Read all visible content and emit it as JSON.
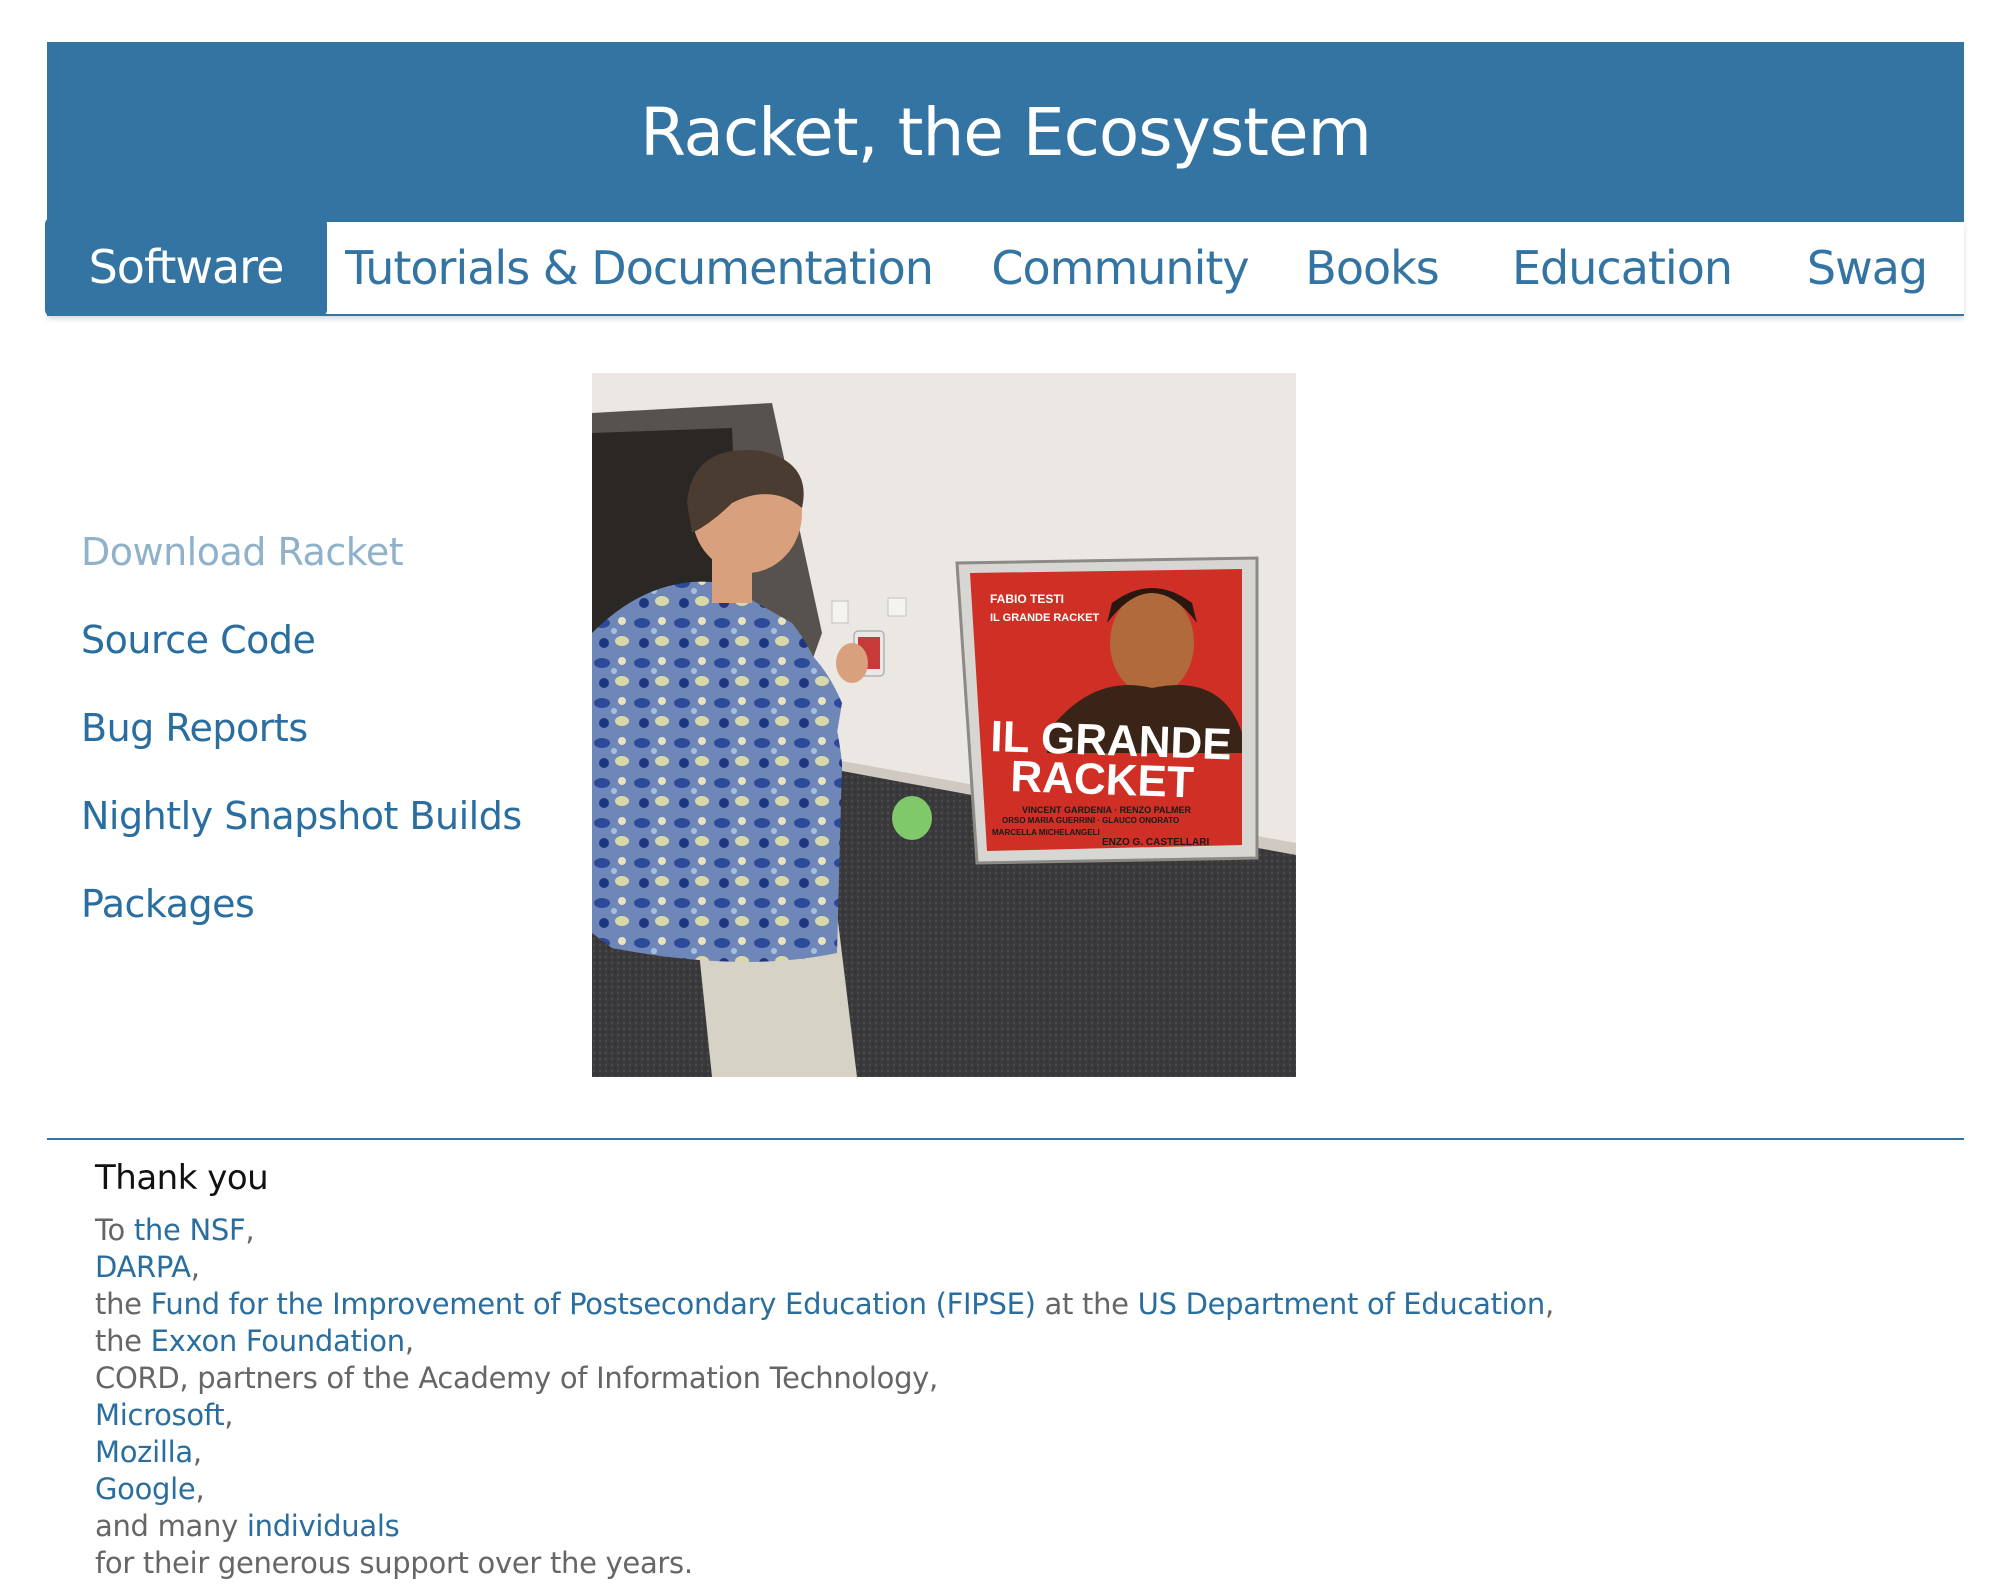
{
  "header": {
    "title": "Racket, the Ecosystem"
  },
  "nav": {
    "items": [
      {
        "label": "Software"
      },
      {
        "label": "Tutorials & Documentation"
      },
      {
        "label": "Community"
      },
      {
        "label": "Books"
      },
      {
        "label": "Education"
      },
      {
        "label": "Swag"
      }
    ],
    "active": "Software"
  },
  "sidebar": {
    "links": [
      {
        "label": "Download Racket"
      },
      {
        "label": "Source Code"
      },
      {
        "label": "Bug Reports"
      },
      {
        "label": "Nightly Snapshot Builds"
      },
      {
        "label": "Packages"
      }
    ]
  },
  "poster": {
    "line1": "FABIO TESTI",
    "line2": "IL GRANDE RACKET",
    "title_a": "IL GRANDE",
    "title_b": "RACKET",
    "credits1": "VINCENT GARDENIA · RENZO PALMER",
    "credits2": "ORSO MARIA GUERRINI · GLAUCO ONORATO",
    "credits3": "MARCELLA MICHELANGELI",
    "director": "ENZO G. CASTELLARI"
  },
  "footer": {
    "title": "Thank you",
    "to": "To ",
    "nsf": "the NSF",
    "comma": ",",
    "darpa": "DARPA",
    "the1": "the ",
    "fipse": "Fund for the Improvement of Postsecondary Education (FIPSE)",
    "at_the": " at the ",
    "usdoe": "US Department of Education",
    "the2": "the ",
    "exxon": "Exxon Foundation",
    "cord": "CORD, partners of the Academy of Information Technology,",
    "microsoft": "Microsoft",
    "mozilla": "Mozilla",
    "google": "Google",
    "and_many": "and many ",
    "individuals": "individuals",
    "closing": "for their generous support over the years."
  },
  "colors": {
    "brand_blue": "#3474a2",
    "link_blue": "#2a6ea0",
    "link_visited": "#8fb1ca"
  }
}
